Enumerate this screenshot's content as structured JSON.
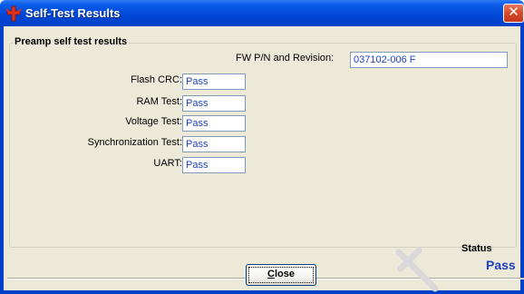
{
  "window": {
    "title": "Self-Test Results",
    "close_glyph": "✕",
    "app_icon": "red-cross-icon"
  },
  "group": {
    "title": "Preamp self test results"
  },
  "fw": {
    "label": "FW P/N and Revision:",
    "value": "037102-006 F"
  },
  "tests": [
    {
      "label": "Flash CRC:",
      "value": "Pass"
    },
    {
      "label": "RAM Test:",
      "value": "Pass"
    },
    {
      "label": "Voltage Test:",
      "value": "Pass"
    },
    {
      "label": "Synchronization Test:",
      "value": "Pass"
    },
    {
      "label": "UART:",
      "value": "Pass"
    }
  ],
  "status": {
    "label": "Status",
    "value": "Pass"
  },
  "buttons": {
    "close_mnemonic": "C",
    "close_rest": "lose"
  },
  "colors": {
    "titlebar": "#0046d6",
    "field_text": "#1f3fbf",
    "dialog_bg": "#ece9d8",
    "close_x_bg": "#d64a2a"
  }
}
